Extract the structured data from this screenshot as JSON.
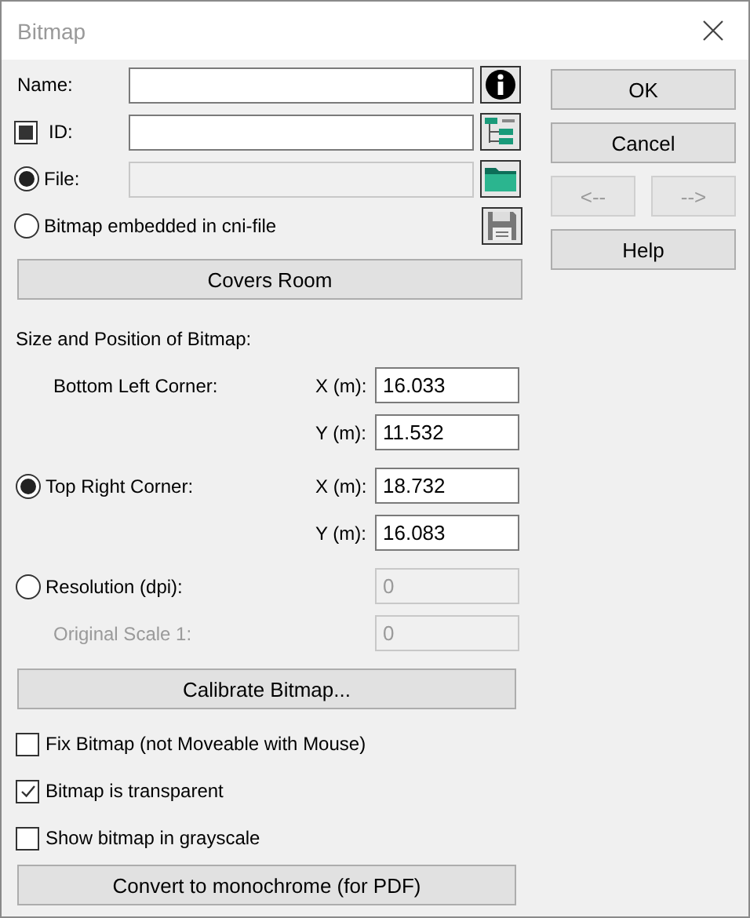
{
  "window": {
    "title": "Bitmap"
  },
  "name_field": {
    "label": "Name:"
  },
  "id_field": {
    "label": "ID:",
    "indeterminate": true
  },
  "file_field": {
    "label": "File:",
    "selected": true,
    "disabled": true
  },
  "embedded_option": {
    "label": "Bitmap embedded in cni-file",
    "selected": false
  },
  "covers_room_button": "Covers Room",
  "section_title": "Size and Position of Bitmap:",
  "corners": [
    {
      "kind": "plain",
      "label": "Bottom Left Corner:",
      "coords": [
        {
          "axis": "X (m):",
          "value": "16.033"
        },
        {
          "axis": "Y (m):",
          "value": "11.532"
        }
      ]
    },
    {
      "kind": "radio",
      "label": "Top Right Corner:",
      "selected": true,
      "coords": [
        {
          "axis": "X (m):",
          "value": "18.732"
        },
        {
          "axis": "Y (m):",
          "value": "16.083"
        }
      ]
    }
  ],
  "resolution": {
    "label": "Resolution (dpi):",
    "selected": false,
    "value": "0",
    "disabled": true
  },
  "original_scale": {
    "label": "Original Scale 1:",
    "value": "0",
    "disabled": true
  },
  "calibrate_button": "Calibrate Bitmap...",
  "checkboxes": [
    {
      "label": "Fix Bitmap (not Moveable with Mouse)",
      "checked": false
    },
    {
      "label": "Bitmap is transparent",
      "checked": true
    },
    {
      "label": "Show bitmap in grayscale",
      "checked": false
    }
  ],
  "convert_button": "Convert to monochrome (for PDF)",
  "buttons": [
    {
      "label": "OK",
      "kind": "wide",
      "disabled": false
    },
    {
      "label": "Cancel",
      "kind": "wide",
      "disabled": false
    },
    {
      "label": "<--",
      "kind": "small",
      "disabled": true
    },
    {
      "label": "-->",
      "kind": "small",
      "disabled": true
    },
    {
      "label": "Help",
      "kind": "wide",
      "disabled": false
    }
  ]
}
